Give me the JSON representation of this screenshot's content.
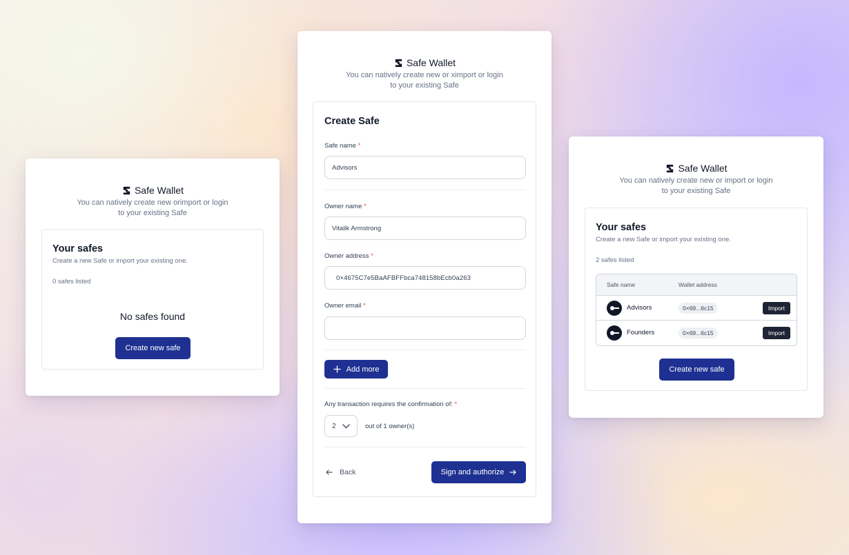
{
  "brand": {
    "name": "Safe Wallet"
  },
  "left_card": {
    "tagline_line1": "You can natively create new orimport or login",
    "tagline_line2": "to your existing Safe",
    "title": "Your safes",
    "subtitle": "Create a new Safe or import your existing one.",
    "count": "0 safes listed",
    "empty_message": "No safes found",
    "create_button": "Create new safe"
  },
  "middle_card": {
    "tagline_line1": "You can natively create new or ximport or login",
    "tagline_line2": "to your existing Safe",
    "title": "Create Safe",
    "fields": {
      "safe_name": {
        "label": "Safe name",
        "value": "Advisors"
      },
      "owner_name": {
        "label": "Owner name",
        "value": "Vitalik Armstrong"
      },
      "owner_address": {
        "label": "Owner address",
        "value": "0×4675C7e5BaAFBFFbca748158bEcb0a263"
      },
      "owner_email": {
        "label": "Owner email",
        "value": ""
      }
    },
    "required_mark": "*",
    "add_more_button": "Add more",
    "confirmation_label": "Any transaction requires the confirmation of:",
    "threshold_value": "2",
    "threshold_suffix": "out of 1 owner(s)",
    "back_button": "Back",
    "submit_button": "Sign and authorize"
  },
  "right_card": {
    "tagline_line1": "You can natively create new or import or login",
    "tagline_line2": "to your existing Safe",
    "title": "Your safes",
    "subtitle": "Create a new Safe or import your existing one.",
    "count": "2 safes listed",
    "table": {
      "columns": [
        "Safe name",
        "Wallet address"
      ],
      "rows": [
        {
          "name": "Advisors",
          "address": "0×69...6c15",
          "action": "Import"
        },
        {
          "name": "Founders",
          "address": "0×69...6c15",
          "action": "Import"
        }
      ]
    },
    "create_button": "Create new safe"
  },
  "colors": {
    "primary": "#1e3192",
    "dark_button": "#1d2433",
    "required": "#e5484d"
  },
  "icons": [
    "safe-logo-icon",
    "plus-icon",
    "chevron-down-icon",
    "arrow-left-icon",
    "arrow-right-icon",
    "safe-avatar-icon"
  ]
}
